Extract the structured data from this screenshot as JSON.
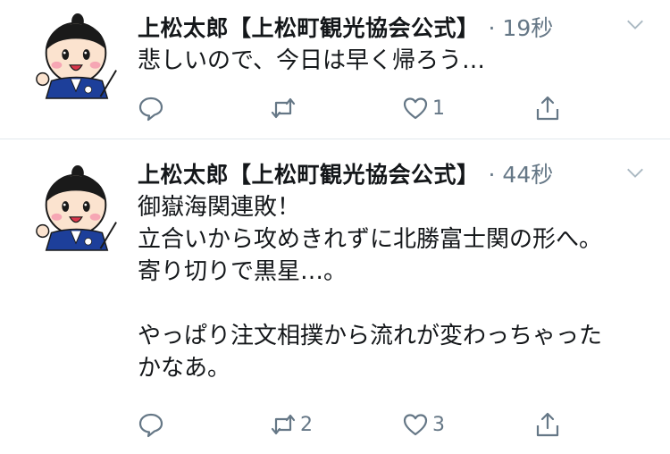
{
  "tweets": [
    {
      "author": "上松太郎【上松町観光協会公式】",
      "time": "· 19秒",
      "body": "悲しいので、今日は早く帰ろう…",
      "reply_count": "",
      "retweet_count": "",
      "like_count": "1"
    },
    {
      "author": "上松太郎【上松町観光協会公式】",
      "time": "· 44秒",
      "body": "御嶽海関連敗！\n立合いから攻めきれずに北勝富士関の形へ。\n寄り切りで黒星…。\n\nやっぱり注文相撲から流れが変わっちゃった\nかなあ。",
      "reply_count": "",
      "retweet_count": "2",
      "like_count": "3"
    }
  ],
  "icons": {
    "reply": "reply-icon",
    "retweet": "retweet-icon",
    "like": "heart-icon",
    "share": "share-icon",
    "more": "chevron-down-icon",
    "avatar": "samurai-mascot-avatar"
  },
  "colors": {
    "text": "#14171a",
    "muted": "#657786",
    "divider": "#e1e8ed",
    "mascot_blue": "#1d3f9a"
  }
}
